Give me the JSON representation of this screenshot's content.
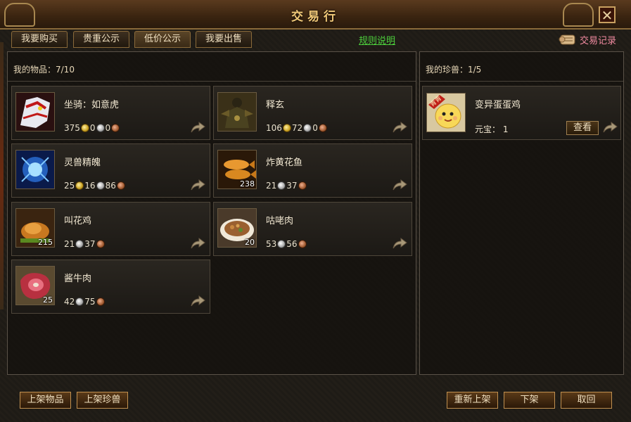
{
  "window": {
    "title": "交易行",
    "close_label": "✕"
  },
  "tabs": [
    {
      "label": "我要购买",
      "active": false
    },
    {
      "label": "贵重公示",
      "active": false
    },
    {
      "label": "低价公示",
      "active": true
    },
    {
      "label": "我要出售",
      "active": false
    }
  ],
  "rules_link": "规则说明",
  "trade_record": "交易记录",
  "items_panel": {
    "title": "我的物品：7/10"
  },
  "pets_panel": {
    "title": "我的珍兽：1/5"
  },
  "items": [
    {
      "name": "坐骑：如意虎",
      "icon": "tiger-mount-icon",
      "qty": "",
      "price": [
        {
          "amount": "375",
          "coin": "gold"
        },
        {
          "amount": "0",
          "coin": "silver"
        },
        {
          "amount": "0",
          "coin": "copper"
        }
      ]
    },
    {
      "name": "释玄",
      "icon": "warrior-portrait-icon",
      "qty": "",
      "price": [
        {
          "amount": "106",
          "coin": "gold"
        },
        {
          "amount": "72",
          "coin": "silver"
        },
        {
          "amount": "0",
          "coin": "copper"
        }
      ]
    },
    {
      "name": "灵兽精魄",
      "icon": "spirit-orb-icon",
      "qty": "",
      "price": [
        {
          "amount": "25",
          "coin": "gold"
        },
        {
          "amount": "16",
          "coin": "silver"
        },
        {
          "amount": "86",
          "coin": "copper"
        }
      ]
    },
    {
      "name": "炸黄花鱼",
      "icon": "fried-fish-icon",
      "qty": "238",
      "price": [
        {
          "amount": "21",
          "coin": "silver"
        },
        {
          "amount": "37",
          "coin": "copper"
        }
      ]
    },
    {
      "name": "叫花鸡",
      "icon": "roast-chicken-icon",
      "qty": "215",
      "price": [
        {
          "amount": "21",
          "coin": "silver"
        },
        {
          "amount": "37",
          "coin": "copper"
        }
      ]
    },
    {
      "name": "咕咾肉",
      "icon": "meat-dish-icon",
      "qty": "20",
      "price": [
        {
          "amount": "53",
          "coin": "silver"
        },
        {
          "amount": "56",
          "coin": "copper"
        }
      ]
    },
    {
      "name": "酱牛肉",
      "icon": "beef-icon",
      "qty": "25",
      "price": [
        {
          "amount": "42",
          "coin": "silver"
        },
        {
          "amount": "75",
          "coin": "copper"
        }
      ]
    }
  ],
  "pet": {
    "name": "变异蛋蛋鸡",
    "yuanbao": "元宝： 1",
    "view_label": "查看",
    "icon": "egg-chick-icon",
    "badge": "青青"
  },
  "buttons": {
    "list_item": "上架物品",
    "list_pet": "上架珍兽",
    "relist": "重新上架",
    "unlist": "下架",
    "retrieve": "取回"
  },
  "colors": {
    "title": "#f0c878",
    "rules_link": "#4ccf3c",
    "record_link": "#f08aa0"
  }
}
